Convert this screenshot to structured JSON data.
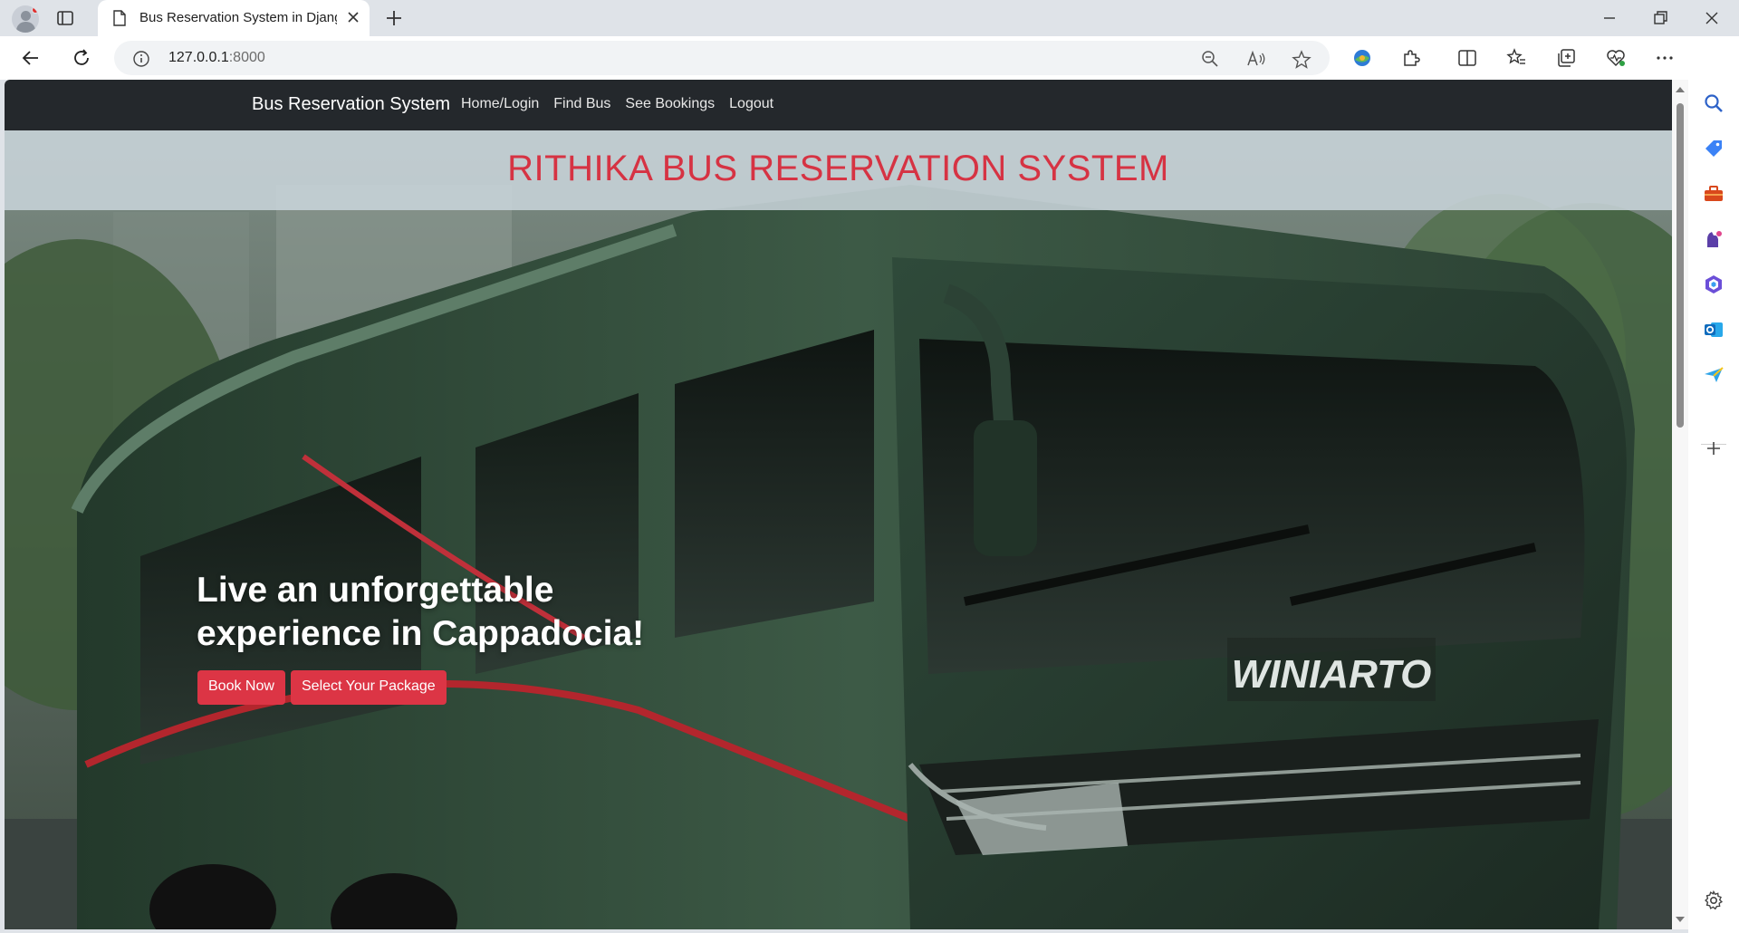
{
  "browser": {
    "tab_title": "Bus Reservation System in Djang",
    "url_host": "127.0.0.1",
    "url_port": ":8000"
  },
  "navbar": {
    "brand": "Bus Reservation System",
    "links": [
      "Home/Login",
      "Find Bus",
      "See Bookings",
      "Logout"
    ]
  },
  "hero": {
    "banner_title": "RITHIKA BUS RESERVATION SYSTEM",
    "headline_line1": "Live an unforgettable",
    "headline_line2": "experience in Cappadocia!",
    "bus_badge": "WINIARTO",
    "book_now_label": "Book Now",
    "select_package_label": "Select Your Package"
  },
  "colors": {
    "accent_red": "#dc3545",
    "banner_title_red": "#d63343",
    "navbar_dark": "#24282c"
  },
  "icons": {
    "tab": "page-icon",
    "omnibox": [
      "zoom-out-icon",
      "read-aloud-icon",
      "favorite-star-icon"
    ],
    "toolbar": [
      "copilot-app-icon",
      "extensions-icon",
      "split-screen-icon",
      "favorites-icon",
      "collections-icon",
      "browser-essentials-icon",
      "more-icon",
      "copilot-icon"
    ],
    "sidebar": [
      "search-icon",
      "shopping-icon",
      "tools-icon",
      "games-icon",
      "microsoft365-icon",
      "outlook-icon",
      "send-icon",
      "add-icon",
      "settings-icon"
    ]
  }
}
